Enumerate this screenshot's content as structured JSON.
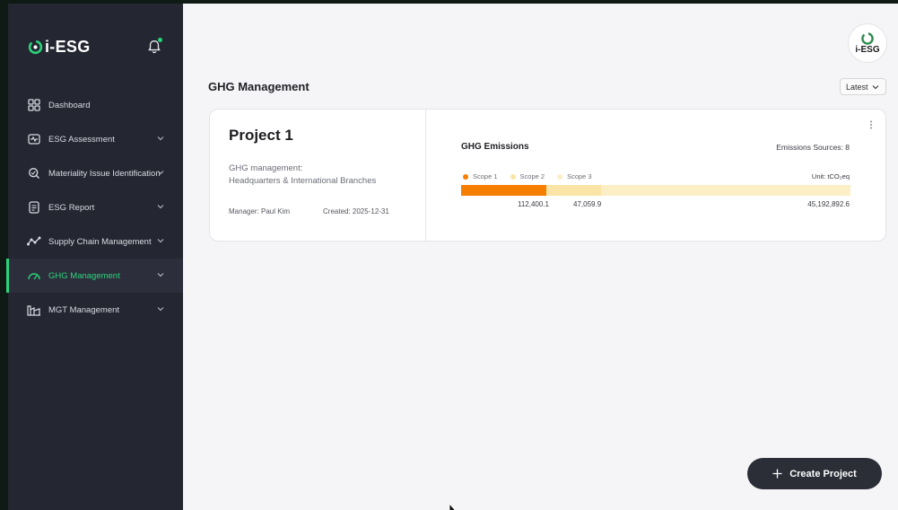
{
  "brand": {
    "logo_text": "i-ESG",
    "avatar_text": "i-ESG"
  },
  "sidebar": {
    "items": [
      {
        "label": "Dashboard",
        "icon": "grid-icon",
        "has_chevron": false,
        "active": false
      },
      {
        "label": "ESG Assessment",
        "icon": "pulse-icon",
        "has_chevron": true,
        "active": false
      },
      {
        "label": "Materiality Issue Identification",
        "icon": "magnifier-icon",
        "has_chevron": true,
        "active": false
      },
      {
        "label": "ESG Report",
        "icon": "document-icon",
        "has_chevron": true,
        "active": false
      },
      {
        "label": "Supply Chain Management",
        "icon": "chain-graph-icon",
        "has_chevron": true,
        "active": false
      },
      {
        "label": "GHG Management",
        "icon": "gauge-icon",
        "has_chevron": true,
        "active": true
      },
      {
        "label": "MGT Management",
        "icon": "factory-icon",
        "has_chevron": true,
        "active": false
      }
    ]
  },
  "main": {
    "title": "GHG Management",
    "sort": {
      "value": "Latest"
    },
    "create_button": "Create Project"
  },
  "project": {
    "title": "Project 1",
    "description_line1": "GHG management:",
    "description_line2": "Headquarters & International Branches",
    "manager": "Manager: Paul Kim",
    "created": "Created: 2025-12-31",
    "emissions": {
      "title": "GHG Emissions",
      "sources": "Emissions Sources: 8",
      "unit": "Unit: tCO₂eq",
      "scopes": [
        {
          "name": "Scope 1",
          "value_label": "112,400.1",
          "color": "#f77f00",
          "share": 0.22
        },
        {
          "name": "Scope 2",
          "value_label": "47,059.9",
          "color": "#fbe5a6",
          "share": 0.14
        },
        {
          "name": "Scope 3",
          "value_label": "45,192,892.6",
          "color": "#fcefc6",
          "share": 0.64
        }
      ]
    }
  },
  "colors": {
    "accent": "#2bd47c",
    "sidebar_bg": "#242631",
    "main_bg": "#f5f5f7",
    "button_bg": "#2b2d37"
  }
}
